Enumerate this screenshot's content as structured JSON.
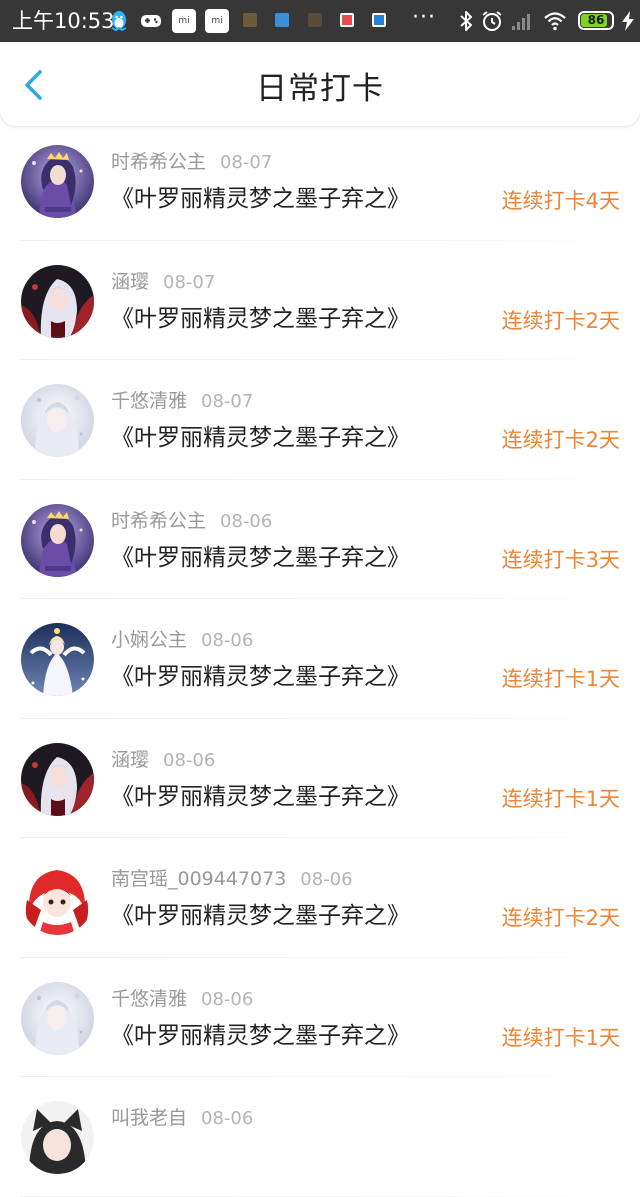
{
  "status_bar": {
    "time": "上午10:53",
    "battery": "86",
    "battery_level": 0.86,
    "colors": {
      "background": "#373737",
      "battery": "#7ed321"
    },
    "icons": [
      "qq-icon",
      "gamepad-icon",
      "mi-icon",
      "mi-icon",
      "app-notification-icon",
      "app-notification-icon",
      "app-notification-icon",
      "app-notification-icon",
      "app-notification-icon",
      "more-dots-icon",
      "bluetooth-icon",
      "alarm-icon",
      "signal-icon",
      "wifi-icon",
      "battery-icon",
      "charging-icon"
    ]
  },
  "header": {
    "title": "日常打卡",
    "back_icon": "chevron-left-icon",
    "colors": {
      "back": "#2aa8ea",
      "title": "#222222"
    }
  },
  "colors": {
    "username": "#999999",
    "date": "#b4b4b4",
    "book": "#222222",
    "streak": "#ee8436"
  },
  "checkins": [
    {
      "name": "时希希公主",
      "date": "08-07",
      "book": "《叶罗丽精灵梦之墨子弃之》",
      "streak": "连续打卡4天",
      "avatar": "princess-purple"
    },
    {
      "name": "涵璎",
      "date": "08-07",
      "book": "《叶罗丽精灵梦之墨子弃之》",
      "streak": "连续打卡2天",
      "avatar": "dark-red-hair"
    },
    {
      "name": "千悠清雅",
      "date": "08-07",
      "book": "《叶罗丽精灵梦之墨子弃之》",
      "streak": "连续打卡2天",
      "avatar": "pale-silver"
    },
    {
      "name": "时希希公主",
      "date": "08-06",
      "book": "《叶罗丽精灵梦之墨子弃之》",
      "streak": "连续打卡3天",
      "avatar": "princess-purple"
    },
    {
      "name": "小娴公主",
      "date": "08-06",
      "book": "《叶罗丽精灵梦之墨子弃之》",
      "streak": "连续打卡1天",
      "avatar": "white-angel"
    },
    {
      "name": "涵璎",
      "date": "08-06",
      "book": "《叶罗丽精灵梦之墨子弃之》",
      "streak": "连续打卡1天",
      "avatar": "dark-red-hair"
    },
    {
      "name": "南宫瑶_009447073",
      "date": "08-06",
      "book": "《叶罗丽精灵梦之墨子弃之》",
      "streak": "连续打卡2天",
      "avatar": "red-hair-girl"
    },
    {
      "name": "千悠清雅",
      "date": "08-06",
      "book": "《叶罗丽精灵梦之墨子弃之》",
      "streak": "连续打卡1天",
      "avatar": "pale-silver"
    },
    {
      "name": "叫我老自",
      "date": "08-06",
      "book": "",
      "streak": "",
      "avatar": "cat-ears"
    }
  ]
}
